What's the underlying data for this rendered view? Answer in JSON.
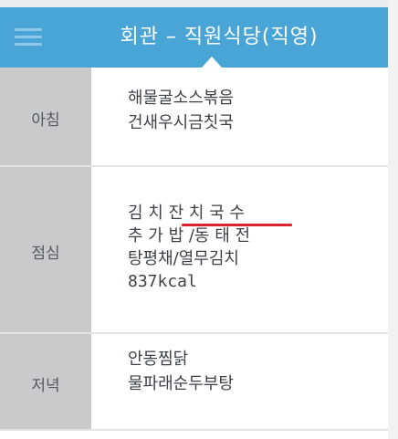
{
  "header": {
    "title": "회관 – 직원식당(직영)"
  },
  "meals": {
    "breakfast": {
      "label": "아침",
      "items": [
        "해물굴소스볶음",
        "건새우시금칫국"
      ]
    },
    "lunch": {
      "label": "점심",
      "items": [
        "김 치 잔 치 국 수",
        "추 가 밥 /동 태 전",
        "탕평채/열무김치",
        "837kcal"
      ]
    },
    "dinner": {
      "label": "저녁",
      "items": [
        "안동찜닭",
        "물파래순두부탕"
      ]
    }
  },
  "colors": {
    "header_bg": "#4aa5d7",
    "label_bg": "#c9cacc",
    "highlight_underline": "#d9232e"
  }
}
